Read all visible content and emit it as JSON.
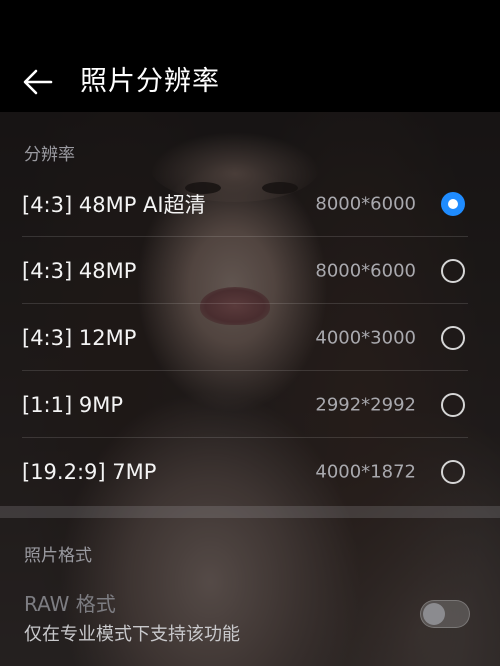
{
  "header": {
    "title": "照片分辨率",
    "back_icon": "arrow-left-icon"
  },
  "resolution_section": {
    "header": "分辨率",
    "options": [
      {
        "label": "[4:3] 48MP AI超清",
        "size": "8000*6000",
        "selected": true
      },
      {
        "label": "[4:3] 48MP",
        "size": "8000*6000",
        "selected": false
      },
      {
        "label": "[4:3] 12MP",
        "size": "4000*3000",
        "selected": false
      },
      {
        "label": "[1:1] 9MP",
        "size": "2992*2992",
        "selected": false
      },
      {
        "label": "[19.2:9] 7MP",
        "size": "4000*1872",
        "selected": false
      }
    ]
  },
  "format_section": {
    "header": "照片格式",
    "raw": {
      "title": "RAW 格式",
      "subtitle": "仅在专业模式下支持该功能",
      "enabled": false
    }
  },
  "colors": {
    "accent": "#1f8cff",
    "background": "#000000",
    "text_primary": "#f4f4f4",
    "text_secondary": "#a9a9ae"
  }
}
